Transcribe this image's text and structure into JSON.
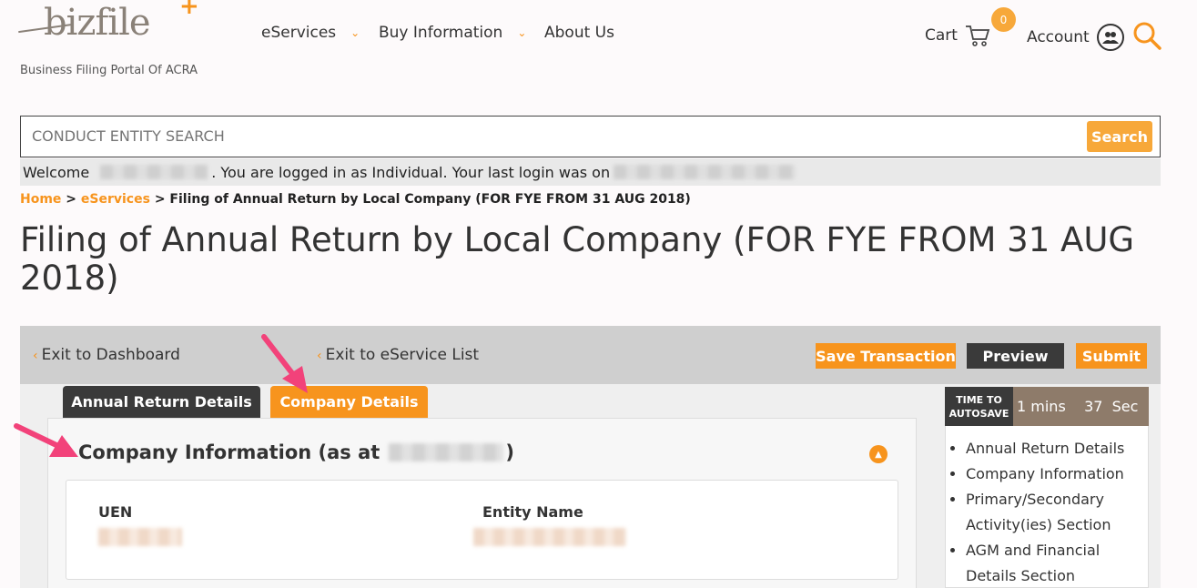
{
  "header": {
    "logo_text": "bizfile",
    "tagline": "Business Filing Portal Of ACRA",
    "nav": [
      {
        "label": "eServices"
      },
      {
        "label": "Buy Information"
      },
      {
        "label": "About Us"
      }
    ],
    "cart_label": "Cart",
    "cart_count": "0",
    "account_label": "Account"
  },
  "search": {
    "placeholder": "CONDUCT ENTITY SEARCH",
    "button_label": "Search"
  },
  "welcome": {
    "prefix": "Welcome",
    "middle": ". You are logged in as Individual. Your last login was on"
  },
  "breadcrumb": {
    "home": "Home",
    "sep": ">",
    "eservices": "eServices",
    "current": "Filing of Annual Return by Local Company (FOR FYE FROM 31 AUG 2018)"
  },
  "page_title": "Filing of Annual Return by Local Company (FOR FYE FROM 31 AUG 2018)",
  "actions": {
    "exit_dashboard": "Exit to Dashboard",
    "exit_eservice": "Exit to eService List",
    "save": "Save Transaction",
    "preview": "Preview",
    "submit": "Submit"
  },
  "tabs": [
    {
      "label": "Annual Return Details"
    },
    {
      "label": "Company Details"
    }
  ],
  "section": {
    "title_prefix": "Company Information (as at",
    "title_suffix": ")",
    "uen_label": "UEN",
    "entity_label": "Entity Name"
  },
  "autosave": {
    "label": "TIME TO AUTOSAVE",
    "value": "1 mins    37  Sec"
  },
  "sidebar": {
    "items": [
      {
        "label": "Annual Return Details"
      },
      {
        "label": "Company Information"
      },
      {
        "label": "Primary/Secondary Activity(ies) Section"
      },
      {
        "label": "AGM and Financial Details Section"
      }
    ]
  },
  "colors": {
    "accent": "#f7941d",
    "dark": "#3a3a3a",
    "arrow": "#f2427a"
  }
}
